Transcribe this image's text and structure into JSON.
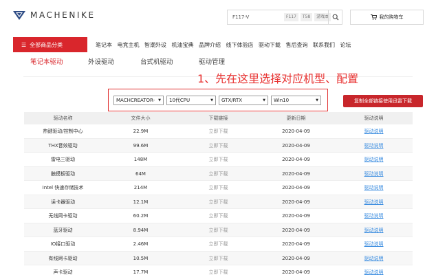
{
  "header": {
    "logo_text": "MACHENIKE",
    "search": {
      "value": "F117-V",
      "chips": [
        "F117",
        "T58",
        "游戏本"
      ]
    },
    "cart_label": "我的购物车"
  },
  "nav": {
    "category_label": "全部商品分类",
    "links": [
      "笔记本",
      "电竞主机",
      "智潮外设",
      "机油宝典",
      "品牌介绍",
      "线下体验店",
      "驱动下载",
      "售后查询",
      "联系我们",
      "论坛"
    ]
  },
  "tabs": [
    "笔记本驱动",
    "外设驱动",
    "台式机驱动",
    "驱动管理"
  ],
  "annotation": "1、先在这里选择对应机型、配置",
  "filters": {
    "model": "MACHCREATOR-",
    "cpu": "10代CPU",
    "gpu": "GTX/RTX",
    "os": "Win10"
  },
  "copy_button": "复制全部链接使用迅雷下载",
  "table": {
    "headers": [
      "驱动名称",
      "文件大小",
      "下载链接",
      "更新日期",
      "驱动说明"
    ],
    "rows": [
      {
        "name": "热键驱动/控制中心",
        "size": "22.9M",
        "link": "立即下载",
        "date": "2020-04-09",
        "desc": "驱动说明"
      },
      {
        "name": "THX音效驱动",
        "size": "99.6M",
        "link": "立即下载",
        "date": "2020-04-09",
        "desc": "驱动说明"
      },
      {
        "name": "雷电三驱动",
        "size": "148M",
        "link": "立即下载",
        "date": "2020-04-09",
        "desc": "驱动说明"
      },
      {
        "name": "触摸板驱动",
        "size": "64M",
        "link": "立即下载",
        "date": "2020-04-09",
        "desc": "驱动说明"
      },
      {
        "name": "Intel 快速存储技术",
        "size": "214M",
        "link": "立即下载",
        "date": "2020-04-09",
        "desc": "驱动说明"
      },
      {
        "name": "读卡器驱动",
        "size": "12.1M",
        "link": "立即下载",
        "date": "2020-04-09",
        "desc": "驱动说明"
      },
      {
        "name": "无线网卡驱动",
        "size": "60.2M",
        "link": "立即下载",
        "date": "2020-04-09",
        "desc": "驱动说明"
      },
      {
        "name": "蓝牙驱动",
        "size": "8.94M",
        "link": "立即下载",
        "date": "2020-04-09",
        "desc": "驱动说明"
      },
      {
        "name": "IO接口驱动",
        "size": "2.46M",
        "link": "立即下载",
        "date": "2020-04-09",
        "desc": "驱动说明"
      },
      {
        "name": "有线网卡驱动",
        "size": "10.5M",
        "link": "立即下载",
        "date": "2020-04-09",
        "desc": "驱动说明"
      },
      {
        "name": "声卡驱动",
        "size": "17.7M",
        "link": "立即下载",
        "date": "2020-04-09",
        "desc": "驱动说明"
      }
    ]
  },
  "colors": {
    "brand_red": "#d9262c",
    "annotation_red": "#e8302f",
    "link_blue": "#3b8de0"
  }
}
